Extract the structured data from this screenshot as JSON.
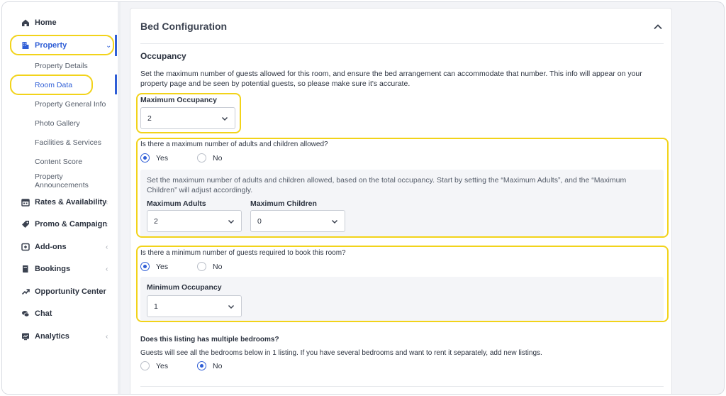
{
  "sidebar": {
    "home": "Home",
    "property": "Property",
    "sub_items": [
      "Property Details",
      "Room Data",
      "Property General Info",
      "Photo Gallery",
      "Facilities & Services",
      "Content Score",
      "Property",
      "Announcements"
    ],
    "rates": "Rates & Availability",
    "promo": "Promo & Campaign",
    "addons": "Add-ons",
    "bookings": "Bookings",
    "opportunity": "Opportunity Center",
    "chat": "Chat",
    "analytics": "Analytics"
  },
  "card": {
    "title": "Bed Configuration",
    "occupancy_heading": "Occupancy",
    "occupancy_desc": "Set the maximum number of guests allowed for this room, and ensure the bed arrangement can accommodate that number. This info will appear on your property page and be seen by potential guests, so please make sure it's accurate.",
    "max_occupancy_label": "Maximum Occupancy",
    "max_occupancy_value": "2",
    "adults_children_question": "Is there a maximum number of adults and children allowed?",
    "yes": "Yes",
    "no": "No",
    "adults_children_desc": "Set the maximum number of adults and children allowed, based on the total occupancy. Start by setting the “Maximum Adults”, and the “Maximum Children” will adjust accordingly.",
    "max_adults_label": "Maximum Adults",
    "max_adults_value": "2",
    "max_children_label": "Maximum Children",
    "max_children_value": "0",
    "min_guests_question": "Is there a minimum number of guests required to book this room?",
    "min_occupancy_label": "Minimum Occupancy",
    "min_occupancy_value": "1",
    "bedrooms_question": "Does this listing has multiple bedrooms?",
    "bedrooms_desc": "Guests will see all the bedrooms below in 1 listing. If you have several bedrooms and want to rent it separately, add new listings."
  },
  "colors": {
    "accent": "#2f5ed6",
    "highlight": "#f2d31a"
  }
}
